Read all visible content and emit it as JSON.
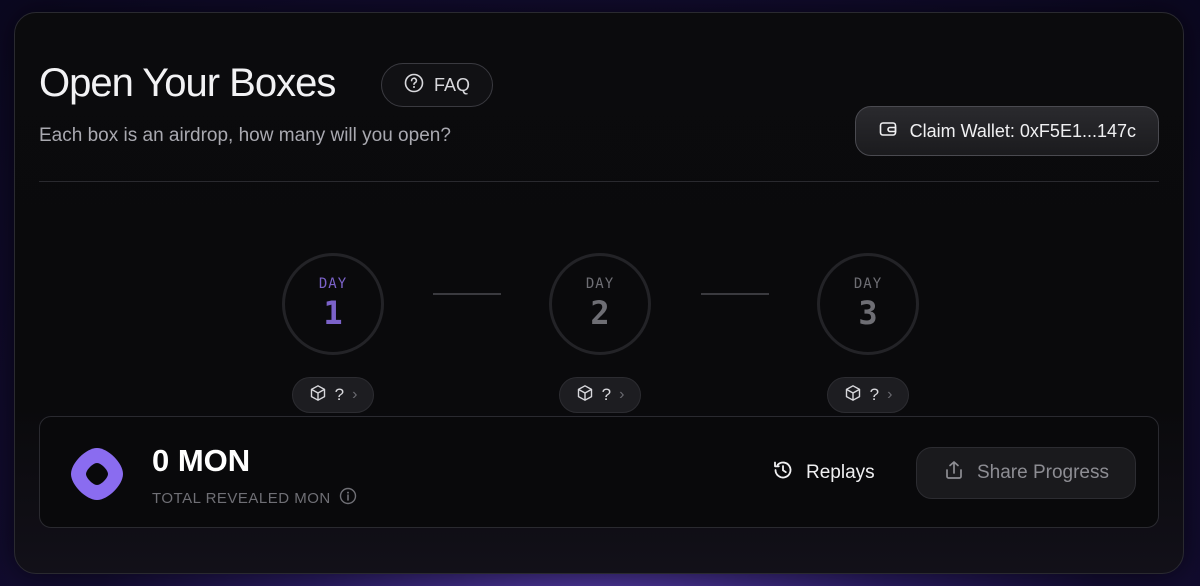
{
  "header": {
    "title": "Open Your Boxes",
    "faq_label": "FAQ",
    "subtitle": "Each box is an airdrop, how many will you open?",
    "claim_wallet_label": "Claim Wallet: 0xF5E1...147c"
  },
  "days": [
    {
      "label": "DAY",
      "number": "1",
      "active": true,
      "box_count": "?"
    },
    {
      "label": "DAY",
      "number": "2",
      "active": false,
      "box_count": "?"
    },
    {
      "label": "DAY",
      "number": "3",
      "active": false,
      "box_count": "?"
    }
  ],
  "summary": {
    "value": "0 MON",
    "label": "TOTAL REVEALED MON",
    "replays_label": "Replays",
    "share_label": "Share Progress"
  },
  "colors": {
    "accent": "#7b62c9",
    "logo": "#8a6cf0"
  },
  "icons": [
    "question-circle-icon",
    "wallet-icon",
    "cube-icon",
    "chevron-right-icon",
    "info-icon",
    "history-icon",
    "share-icon",
    "mon-logo"
  ]
}
